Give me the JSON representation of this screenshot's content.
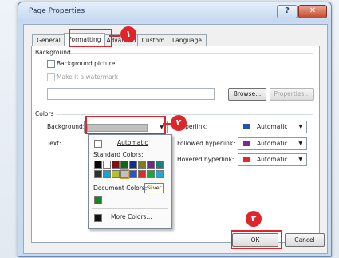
{
  "window": {
    "title": "Page Properties",
    "help_symbol": "?",
    "close_symbol": "✕"
  },
  "tabs": [
    {
      "label": "General"
    },
    {
      "label": "Formatting"
    },
    {
      "label": "Advanced"
    },
    {
      "label": "Custom"
    },
    {
      "label": "Language"
    }
  ],
  "background_section": {
    "legend": "Background",
    "picture_label": "Background picture",
    "watermark_label": "Make it a watermark",
    "browse_label": "Browse...",
    "properties_label": "Properties..."
  },
  "colors_section": {
    "legend": "Colors",
    "background_label": "Background:",
    "text_label": "Text:",
    "hyperlink_label": "Hyperlink:",
    "followed_label": "Followed hyperlink:",
    "hover_label": "Hovered hyperlink:",
    "hyperlink_value": "Automatic",
    "followed_value": "Automatic",
    "hover_value": "Automatic",
    "hyperlink_color": "#2b4fb0",
    "followed_color": "#7b2a93",
    "hover_color": "#e12b2b"
  },
  "color_popup": {
    "automatic_label": "Automatic",
    "standard_label": "Standard Colors:",
    "document_label": "Document Colors:",
    "tooltip": "Silver",
    "more_label": "More Colors...",
    "standard_row1": [
      "#000000",
      "#ffffff",
      "#7f1313",
      "#0e6a12",
      "#142e8c",
      "#7e7d16",
      "#6b2b84",
      "#1f7d7d"
    ],
    "standard_row2": [
      "#2f2f2f",
      "#17a1d8",
      "#b7bf31",
      "#c0c0c0",
      "#2757c4",
      "#e22a2a",
      "#1ea63c",
      "#2aa3cf"
    ],
    "document_color": "#14862a"
  },
  "buttons": {
    "ok": "OK",
    "cancel": "Cancel"
  },
  "annotations": {
    "step1": "١",
    "step2": "٢",
    "step3": "٣"
  }
}
